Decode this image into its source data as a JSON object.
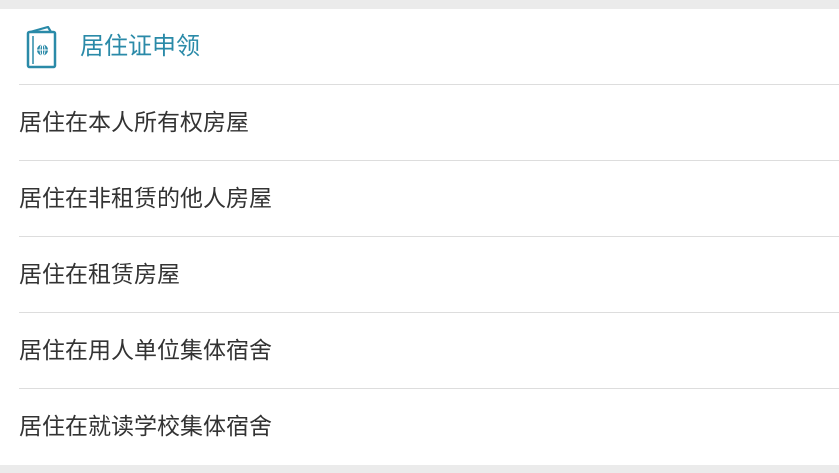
{
  "section": {
    "title": "居住证申领",
    "icon": "passport-icon",
    "accent_color": "#2a8aa8"
  },
  "options": [
    {
      "label": "居住在本人所有权房屋"
    },
    {
      "label": "居住在非租赁的他人房屋"
    },
    {
      "label": "居住在租赁房屋"
    },
    {
      "label": "居住在用人单位集体宿舍"
    },
    {
      "label": "居住在就读学校集体宿舍"
    }
  ]
}
